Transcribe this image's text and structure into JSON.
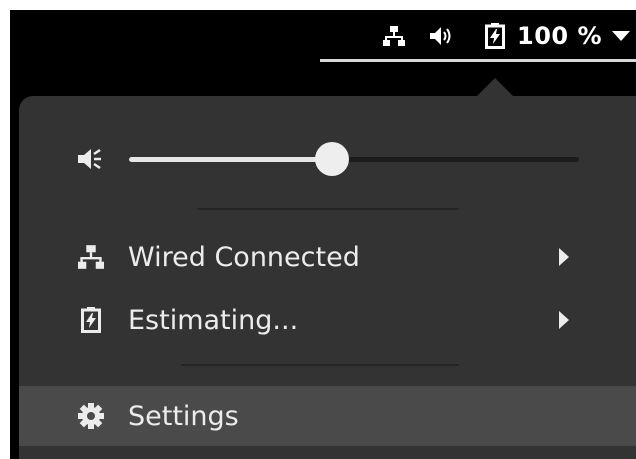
{
  "panel": {
    "battery_percent": "100 %"
  },
  "menu": {
    "volume_level": 0.45,
    "items": [
      {
        "label": "Wired Connected",
        "icon": "network-wired-icon",
        "has_submenu": true
      },
      {
        "label": "Estimating...",
        "icon": "battery-charging-icon",
        "has_submenu": true
      },
      {
        "label": "Settings",
        "icon": "gear-icon",
        "has_submenu": false
      }
    ]
  },
  "colors": {
    "panel_bg": "#000000",
    "menu_bg": "#333333",
    "hover_bg": "#4a4a4a",
    "text": "#ececec"
  }
}
